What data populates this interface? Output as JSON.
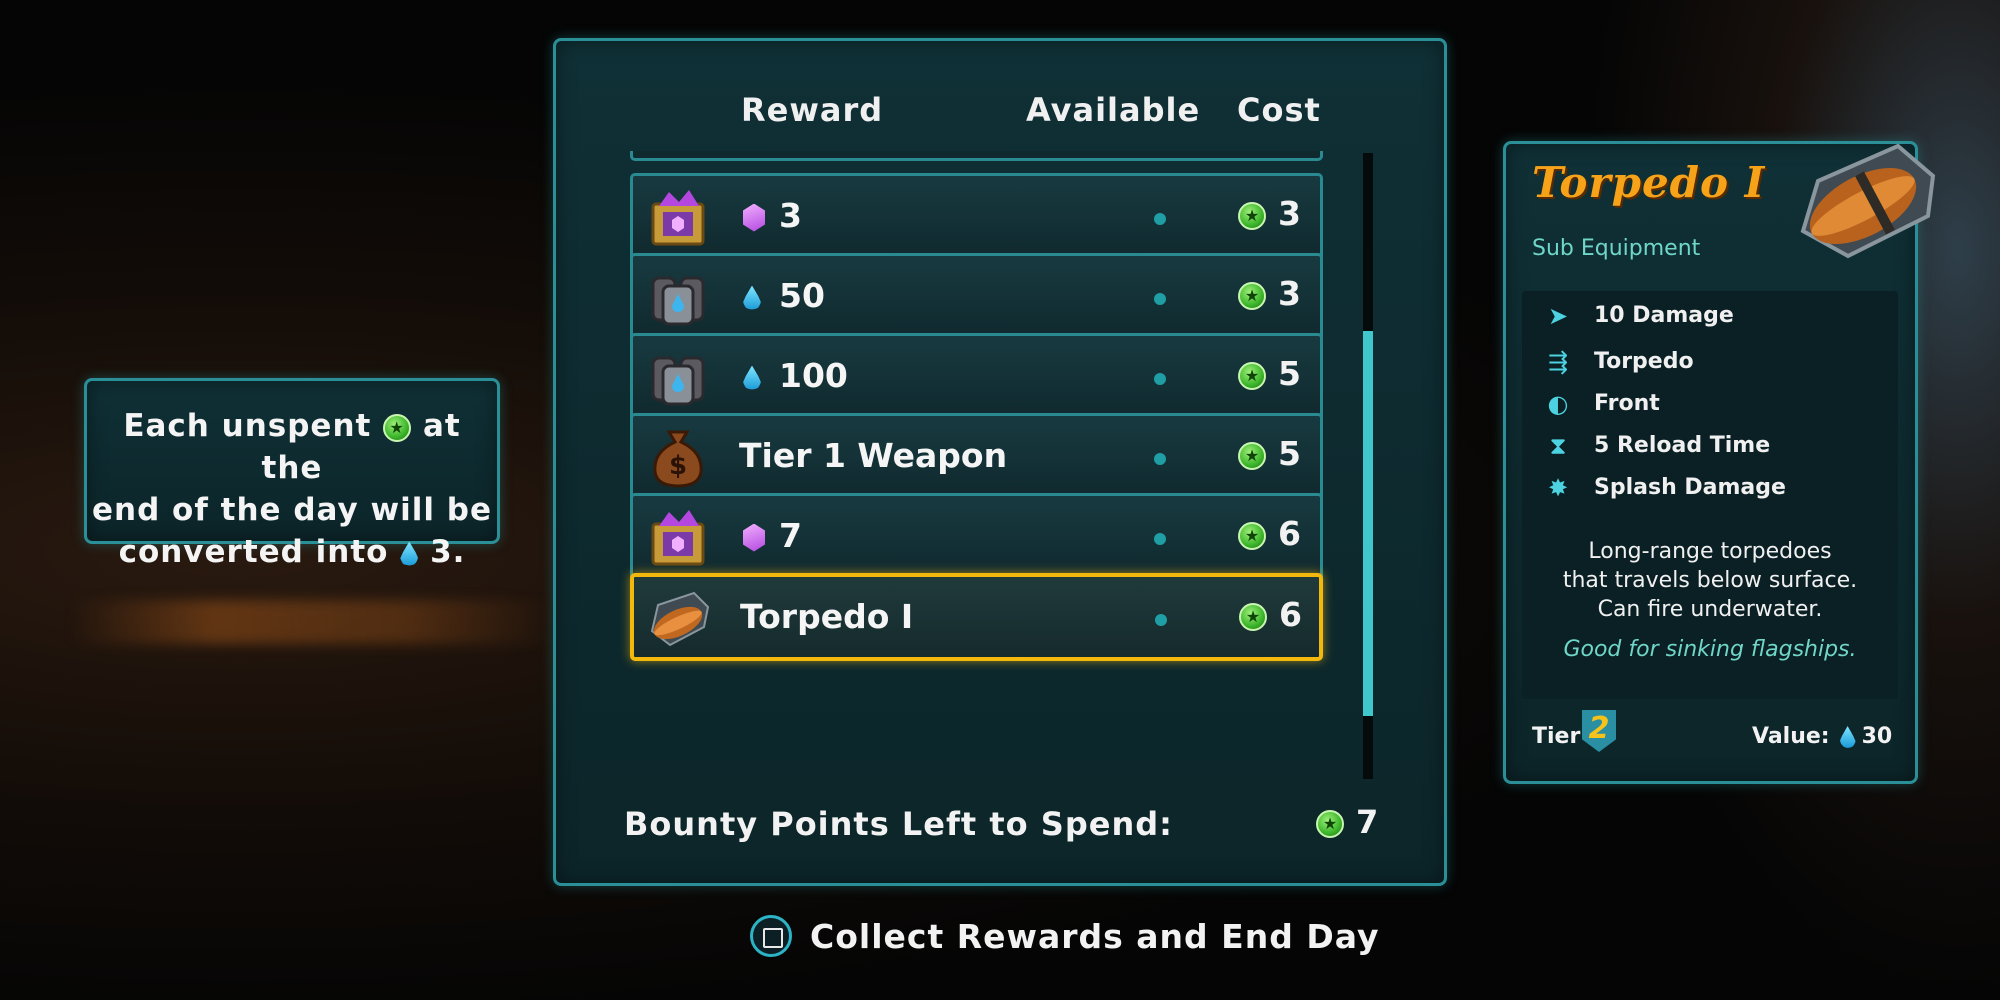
{
  "tooltip": {
    "line1_a": "Each unspent",
    "line1_b": "at the",
    "line2": "end of the day will be",
    "line3_a": "converted into",
    "line3_b": "3."
  },
  "table": {
    "headers": {
      "reward": "Reward",
      "available": "Available",
      "cost": "Cost"
    },
    "rows": [
      {
        "icon": "gem-crate-icon",
        "currency": "gem",
        "label": "3",
        "cost": "3",
        "selected": false
      },
      {
        "icon": "water-jug-icon",
        "currency": "water",
        "label": "50",
        "cost": "3",
        "selected": false
      },
      {
        "icon": "water-jug-icon",
        "currency": "water",
        "label": "100",
        "cost": "5",
        "selected": false
      },
      {
        "icon": "money-bag-icon",
        "currency": "none",
        "label": "Tier 1 Weapon",
        "cost": "5",
        "selected": false
      },
      {
        "icon": "gem-crate-icon",
        "currency": "gem",
        "label": "7",
        "cost": "6",
        "selected": false
      },
      {
        "icon": "torpedo-icon",
        "currency": "none",
        "label": "Torpedo I",
        "cost": "6",
        "selected": true
      }
    ],
    "bounty_label": "Bounty Points Left to Spend:",
    "bounty_value": "7"
  },
  "card": {
    "title": "Torpedo I",
    "subtitle": "Sub Equipment",
    "stats": [
      {
        "icon": "damage-icon",
        "label": "10 Damage"
      },
      {
        "icon": "torpedo-type-icon",
        "label": "Torpedo"
      },
      {
        "icon": "direction-icon",
        "label": "Front"
      },
      {
        "icon": "hourglass-icon",
        "label": "5 Reload Time"
      },
      {
        "icon": "splash-icon",
        "label": "Splash Damage"
      }
    ],
    "description": [
      "Long-range torpedoes",
      "that travels below surface.",
      "Can fire underwater."
    ],
    "flavor": "Good for sinking flagships.",
    "tier_label": "Tier",
    "tier_value": "2",
    "value_label": "Value:",
    "value_amount": "30"
  },
  "action": {
    "label": "Collect Rewards and End Day"
  },
  "colors": {
    "accent": "#2b8f97",
    "selected": "#f2b80c",
    "title": "#f7a31a",
    "coin": "#3bb52a"
  }
}
